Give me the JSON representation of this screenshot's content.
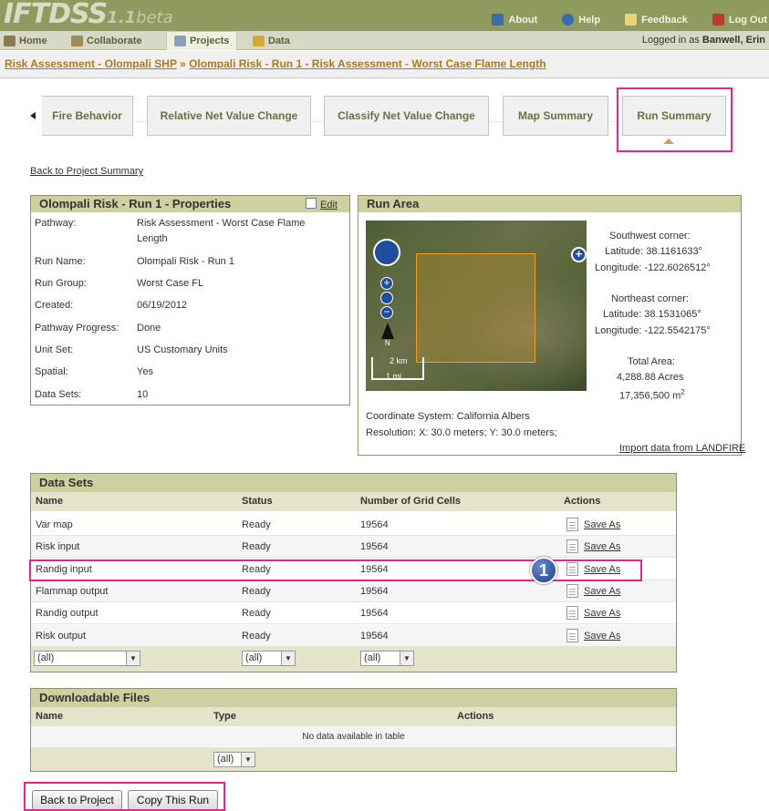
{
  "app": {
    "logo": "IFTDSS",
    "version": "1.1",
    "version_suffix": "beta"
  },
  "toplinks": [
    {
      "label": "About",
      "icon": "help-book-icon"
    },
    {
      "label": "Help",
      "icon": "question-icon"
    },
    {
      "label": "Feedback",
      "icon": "pencil-note-icon"
    },
    {
      "label": "Log Out",
      "icon": "exit-door-icon"
    }
  ],
  "nav": [
    {
      "label": "Home",
      "icon": "house-icon"
    },
    {
      "label": "Collaborate",
      "icon": "people-icon"
    },
    {
      "label": "Projects",
      "icon": "folder-icon",
      "active": true
    },
    {
      "label": "Data",
      "icon": "books-icon"
    }
  ],
  "user": {
    "prefix": "Logged in as",
    "name": "Banwell, Erin"
  },
  "breadcrumb": {
    "part1": "Risk Assessment - Olompali SHP",
    "sep": " » ",
    "part2": "Olompali Risk - Run 1 - Risk Assessment - Worst Case Flame Length"
  },
  "steps": [
    "Fire Behavior",
    "Relative Net Value Change",
    "Classify Net Value Change",
    "Map Summary",
    "Run Summary"
  ],
  "back_link": "Back to Project Summary",
  "properties": {
    "title": "Olompali Risk - Run 1 - Properties",
    "edit": "Edit",
    "rows": [
      {
        "k": "Pathway:",
        "v": "Risk Assessment - Worst Case Flame",
        "v2": "Length"
      },
      {
        "k": "Run Name:",
        "v": "Olompali Risk - Run 1"
      },
      {
        "k": "Run Group:",
        "v": "Worst Case FL"
      },
      {
        "k": "Created:",
        "v": "06/19/2012"
      },
      {
        "k": "Pathway Progress:",
        "v": "Done"
      },
      {
        "k": "Unit Set:",
        "v": "US Customary Units"
      },
      {
        "k": "Spatial:",
        "v": "Yes"
      },
      {
        "k": "Data Sets:",
        "v": "10"
      }
    ]
  },
  "run_area": {
    "title": "Run Area",
    "sw": "Southwest corner:",
    "sw_lat": "Latitude: 38.1161633°",
    "sw_lon": "Longitude: -122.6026512°",
    "ne": "Northeast corner:",
    "ne_lat": "Latitude: 38.1531065°",
    "ne_lon": "Longitude: -122.5542175°",
    "total": "Total Area:",
    "acres": "4,288.88 Acres",
    "sqm": "17,356,500 m",
    "sqm_sup": "2",
    "coord": "Coordinate System: California Albers",
    "res": "Resolution: X: 30.0 meters; Y: 30.0 meters;",
    "import": "Import data from LANDFIRE",
    "scale_km": "2 km",
    "scale_mi": "1 mi",
    "north": "N"
  },
  "datasets": {
    "title": "Data Sets",
    "headers": [
      "Name",
      "Status",
      "Number of Grid Cells",
      "Actions"
    ],
    "rows": [
      {
        "name": "Var map",
        "status": "Ready",
        "cells": "19564",
        "action": "Save As"
      },
      {
        "name": "Risk input",
        "status": "Ready",
        "cells": "19564",
        "action": "Save As"
      },
      {
        "name": "Randig input",
        "status": "Ready",
        "cells": "19564",
        "action": "Save As"
      },
      {
        "name": "Flammap output",
        "status": "Ready",
        "cells": "19564",
        "action": "Save As"
      },
      {
        "name": "Randig output",
        "status": "Ready",
        "cells": "19564",
        "action": "Save As"
      },
      {
        "name": "Risk output",
        "status": "Ready",
        "cells": "19564",
        "action": "Save As"
      }
    ],
    "filters": [
      "(all)",
      "(all)",
      "(all)"
    ],
    "callout": "1"
  },
  "downloads": {
    "title": "Downloadable Files",
    "headers": [
      "Name",
      "Type",
      "Actions"
    ],
    "empty": "No data available in table",
    "filter": "(all)"
  },
  "buttons": {
    "back": "Back to Project",
    "copy": "Copy This Run"
  },
  "colors": {
    "highlight": "#e6268f",
    "panel_header": "#cfd09f",
    "topbar": "#8f9a5e"
  }
}
